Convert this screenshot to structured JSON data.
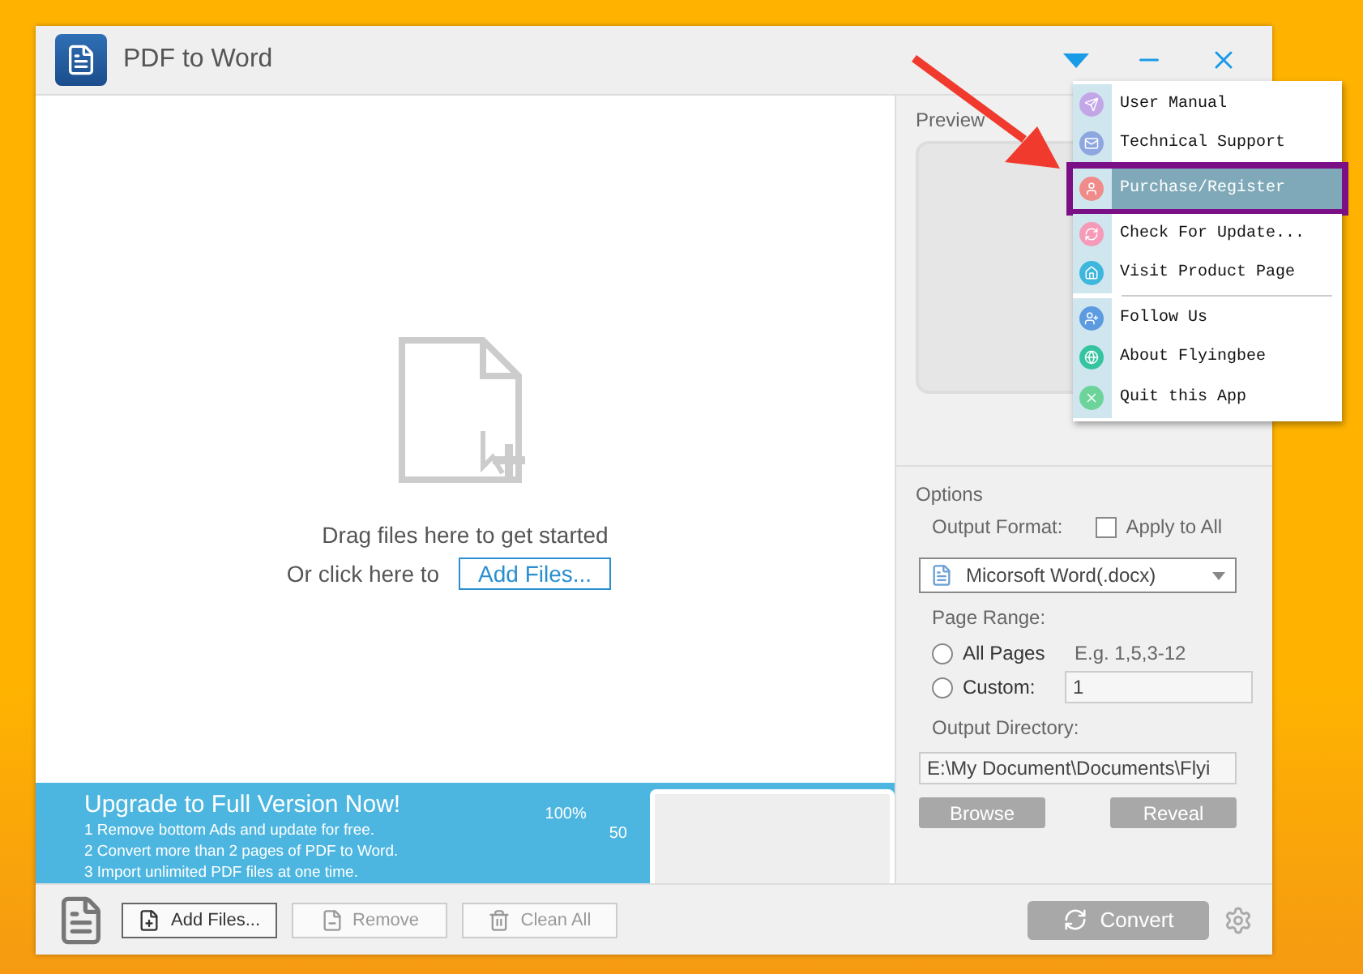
{
  "window": {
    "title": "PDF to Word"
  },
  "drop_zone": {
    "prompt": "Drag files here to get started",
    "click_prefix": "Or click here to",
    "add_link": "Add Files..."
  },
  "banner": {
    "title": "Upgrade to Full Version Now!",
    "lines": [
      "1 Remove bottom Ads and update for free.",
      "2 Convert more than 2 pages of PDF to Word.",
      "3 Import unlimited PDF files at one time."
    ],
    "graphic_labels": [
      "100%",
      "50"
    ]
  },
  "toolbar": {
    "buttons": [
      {
        "label": "Add Files...",
        "kind": "add",
        "disabled": false
      },
      {
        "label": "Remove",
        "kind": "remove",
        "disabled": true
      },
      {
        "label": "Clean All",
        "kind": "clean",
        "disabled": true
      }
    ]
  },
  "preview": {
    "label": "Preview"
  },
  "options": {
    "heading": "Options",
    "output_format_label": "Output Format:",
    "apply_to_all": {
      "label": "Apply to All",
      "checked": false
    },
    "format_value": "Micorsoft Word(.docx)",
    "page_range_label": "Page Range:",
    "hint": "E.g. 1,5,3-12",
    "ranges": [
      {
        "label": "All Pages",
        "selected": false
      },
      {
        "label": "Custom:",
        "selected": false
      }
    ],
    "custom_value": "1",
    "output_dir_label": "Output Directory:",
    "output_dir_value": "E:\\My Document\\Documents\\Flyi",
    "browse": {
      "label": "Browse",
      "disabled": true
    },
    "reveal": {
      "label": "Reveal",
      "disabled": true
    }
  },
  "convert": {
    "label": "Convert",
    "disabled": true
  },
  "menu": {
    "groups": [
      [
        {
          "label": "User Manual",
          "color": "#c3a6e8",
          "selected": false
        },
        {
          "label": "Technical Support",
          "color": "#8fa7e0",
          "selected": false
        },
        {
          "label": "Purchase/Register",
          "color": "#f08b8b",
          "selected": true
        },
        {
          "label": "Check For Update...",
          "color": "#f59ab8",
          "selected": false
        },
        {
          "label": "Visit Product Page",
          "color": "#3fb7dc",
          "selected": false
        }
      ],
      [
        {
          "label": "Follow Us",
          "color": "#5c9be0",
          "selected": false
        },
        {
          "label": "About Flyingbee",
          "color": "#35c4a0",
          "selected": false
        },
        {
          "label": "Quit this App",
          "color": "#6cd49a",
          "selected": false
        }
      ]
    ]
  }
}
